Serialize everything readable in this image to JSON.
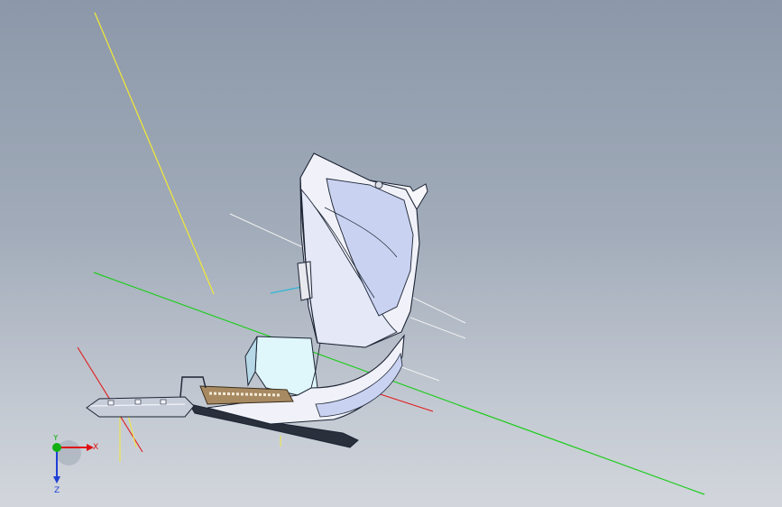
{
  "viewport": {
    "background_top": "#8c98a9",
    "background_bottom": "#d2d6dc",
    "model_edge_color": "#1c2434",
    "model_face_color": "#f1f2f9",
    "model_shade_color": "#c9d2f0",
    "wire_yellow": "#f4ea34",
    "wire_green": "#22cc22",
    "wire_red": "#e21c1c",
    "wire_white": "#f2f2f2",
    "wire_cyan": "#2fb7d6",
    "tan_part": "#a88a62",
    "dark_part": "#2a2f3c",
    "glass_part": "#dff6fb"
  },
  "triad": {
    "x_label": "X",
    "y_label": "Y",
    "z_label": "Z",
    "x_color": "#e01010",
    "y_color": "#12b012",
    "z_color": "#1e3fd6",
    "icon": "reference-triad-icon"
  }
}
